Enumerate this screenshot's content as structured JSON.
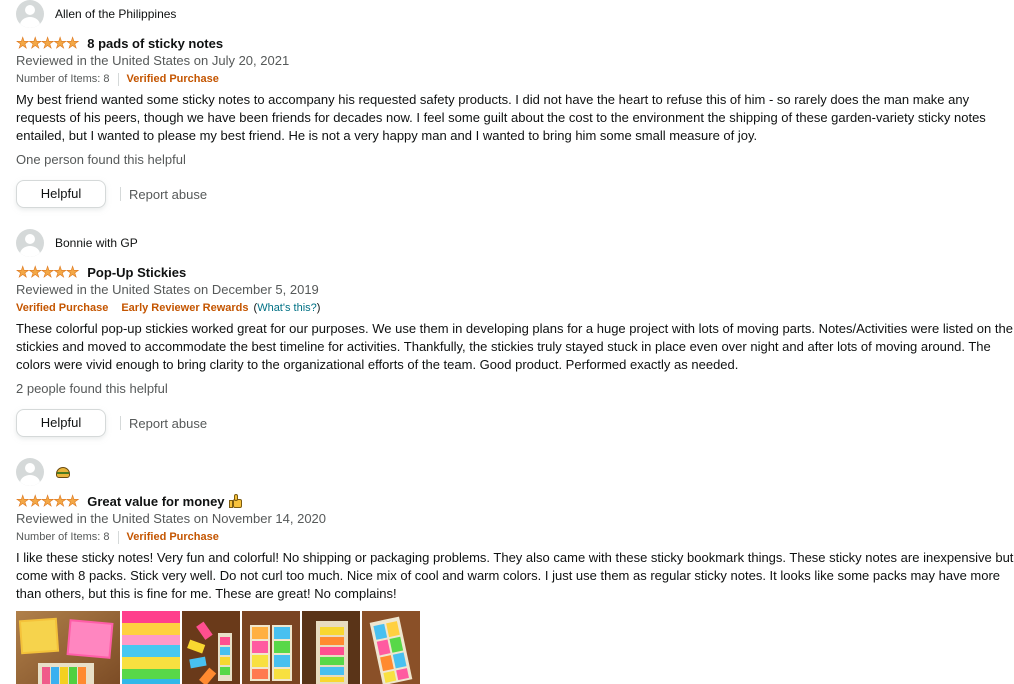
{
  "reviews": [
    {
      "reviewer": "Allen of the Philippines",
      "rating": 5,
      "title": "8 pads of sticky notes",
      "date": "Reviewed in the United States on July 20, 2021",
      "items": "Number of Items: 8",
      "verified": "Verified Purchase",
      "text": "My best friend wanted some sticky notes to accompany his requested safety products. I did not have the heart to refuse this of him - so rarely does the man make any requests of his peers, though we have been friends for decades now. I feel some guilt about the cost to the environment the shipping of these garden-variety sticky notes entailed, but I wanted to please my best friend. He is not a very happy man and I wanted to bring him some small measure of joy.",
      "helpful_count": "One person found this helpful",
      "helpful_label": "Helpful",
      "report_label": "Report abuse"
    },
    {
      "reviewer": "Bonnie with GP",
      "rating": 5,
      "title": "Pop-Up Stickies",
      "date": "Reviewed in the United States on December 5, 2019",
      "verified": "Verified Purchase",
      "early_reviewer": "Early Reviewer Rewards",
      "whats_this": "What's this?",
      "text": "These colorful pop-up stickies worked great for our purposes. We use them in developing plans for a huge project with lots of moving parts. Notes/Activities were listed on the stickies and moved to accommodate the best timeline for activities. Thankfully, the stickies truly stayed stuck in place even over night and after lots of moving around. The colors were vivid enough to bring clarity to the organizational efforts of the team. Good product. Performed exactly as needed.",
      "helpful_count": "2 people found this helpful",
      "helpful_label": "Helpful",
      "report_label": "Report abuse"
    },
    {
      "reviewer_icon": "taco-emoji-icon",
      "rating": 5,
      "title": "Great value for money",
      "title_icon": "thumbs-up-icon",
      "date": "Reviewed in the United States on November 14, 2020",
      "items": "Number of Items: 8",
      "verified": "Verified Purchase",
      "text": "I like these sticky notes! Very fun and colorful! No shipping or packaging problems. They also came with these sticky bookmark things. These sticky notes are inexpensive but come with 8 packs. Stick very well. Do not curl too much. Nice mix of cool and warm colors. I just use them as regular sticky notes. It looks like some packs may have more than others, but this is fine for me. These are great! No complains!",
      "photo_count": 6
    }
  ],
  "colors": {
    "star": "#f3a847",
    "verified": "#c45500",
    "link": "#007185",
    "secondary_text": "#565959"
  }
}
